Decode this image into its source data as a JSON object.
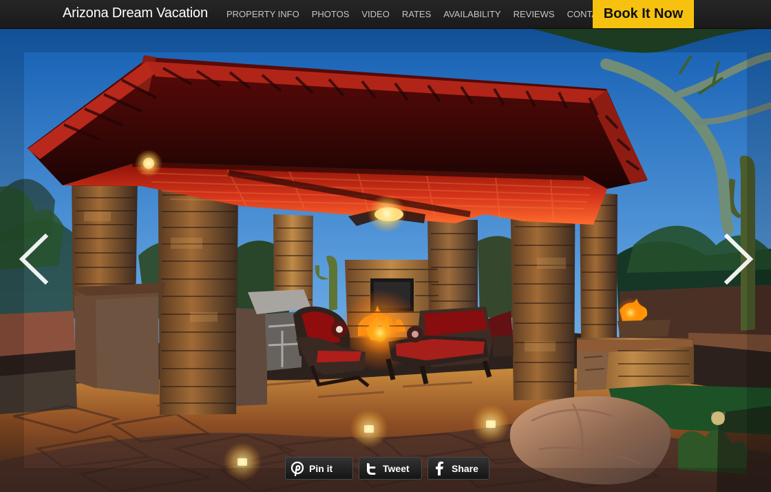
{
  "header": {
    "title": "Arizona Dream Vacation",
    "nav": [
      {
        "label": "PROPERTY INFO",
        "name": "nav-property-info"
      },
      {
        "label": "PHOTOS",
        "name": "nav-photos"
      },
      {
        "label": "VIDEO",
        "name": "nav-video"
      },
      {
        "label": "RATES",
        "name": "nav-rates"
      },
      {
        "label": "AVAILABILITY",
        "name": "nav-availability"
      },
      {
        "label": "REVIEWS",
        "name": "nav-reviews"
      },
      {
        "label": "CONTACT",
        "name": "nav-contact"
      }
    ],
    "cta": {
      "label": "Book It Now"
    }
  },
  "slider": {
    "prev_icon": "chevron-left-icon",
    "next_icon": "chevron-right-icon"
  },
  "share": {
    "pin": {
      "label": "Pin it",
      "icon": "pinterest-icon"
    },
    "tweet": {
      "label": "Tweet",
      "icon": "twitter-icon"
    },
    "facebook": {
      "label": "Share",
      "icon": "facebook-icon"
    }
  },
  "colors": {
    "header_bg": "#1f1f1f",
    "nav_text": "#c6c6c6",
    "cta_bg": "#f6c20f",
    "sky_top": "#1d6fc1",
    "roof_red": "#9f1d14"
  }
}
